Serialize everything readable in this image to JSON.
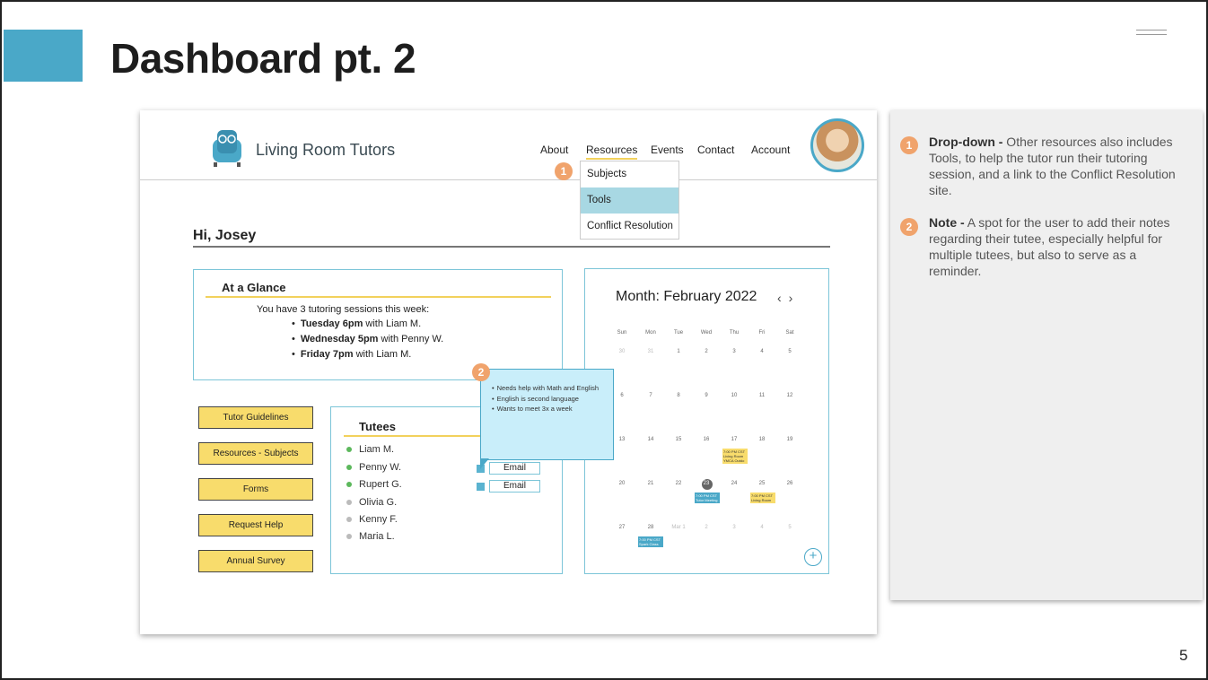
{
  "slide": {
    "title": "Dashboard pt. 2",
    "page_number": "5"
  },
  "app": {
    "brand": "Living Room Tutors",
    "nav": [
      "About",
      "Resources",
      "Events",
      "Contact",
      "Account"
    ],
    "dropdown": [
      "Subjects",
      "Tools",
      "Conflict Resolution"
    ],
    "greeting": "Hi, Josey"
  },
  "glance": {
    "title": "At a Glance",
    "intro": "You have 3 tutoring sessions this week:",
    "sessions": [
      {
        "when": "Tuesday 6pm",
        "who": " with Liam M."
      },
      {
        "when": "Wednesday 5pm",
        "who": " with Penny W."
      },
      {
        "when": "Friday 7pm",
        "who": " with Liam M."
      }
    ]
  },
  "side_buttons": [
    "Tutor Guidelines",
    "Resources - Subjects",
    "Forms",
    "Request Help",
    "Annual Survey"
  ],
  "tutees": {
    "title": "Tutees",
    "list": [
      "Liam M.",
      "Penny W.",
      "Rupert G.",
      "Olivia G.",
      "Kenny F.",
      "Maria L."
    ],
    "email_label": "Email"
  },
  "note_popup": [
    "Needs help with Math and English",
    "English is second language",
    "Wants to meet 3x a week"
  ],
  "calendar": {
    "title": "Month: February 2022",
    "prev": "‹",
    "next": "›",
    "dow": [
      "Sun",
      "Mon",
      "Tue",
      "Wed",
      "Thu",
      "Fri",
      "Sat"
    ],
    "weeks": [
      [
        "30",
        "31",
        "1",
        "2",
        "3",
        "4",
        "5"
      ],
      [
        "6",
        "7",
        "8",
        "9",
        "10",
        "11",
        "12"
      ],
      [
        "13",
        "14",
        "15",
        "16",
        "17",
        "18",
        "19"
      ],
      [
        "20",
        "21",
        "22",
        "23",
        "24",
        "25",
        "26"
      ],
      [
        "27",
        "28",
        "Mar 1",
        "2",
        "3",
        "4",
        "5"
      ]
    ],
    "events": [
      {
        "text": "7:00 PM CST Living Room YMCA Outdo"
      },
      {
        "text": "7:00 PM CST Tutor Meeting"
      },
      {
        "text": "7:00 PM CST Living Room"
      },
      {
        "text": "7:00 PM CST Spark Class"
      }
    ],
    "add": "+"
  },
  "notes": [
    {
      "badge": "1",
      "title": "Drop-down -",
      "text": " Other resources also includes Tools, to help the tutor run their tutoring session, and a link to the Conflict Resolution site."
    },
    {
      "badge": "2",
      "title": "Note -",
      "text": " A spot for the user to add their notes regarding their tutee, especially helpful for multiple tutees, but also to serve as a reminder."
    }
  ],
  "colors": {
    "accent": "#4aa8c8",
    "yellow": "#f8dc6c",
    "badge": "#f0a36c",
    "online": "#5cb85c",
    "offline": "#bbbbbb"
  }
}
